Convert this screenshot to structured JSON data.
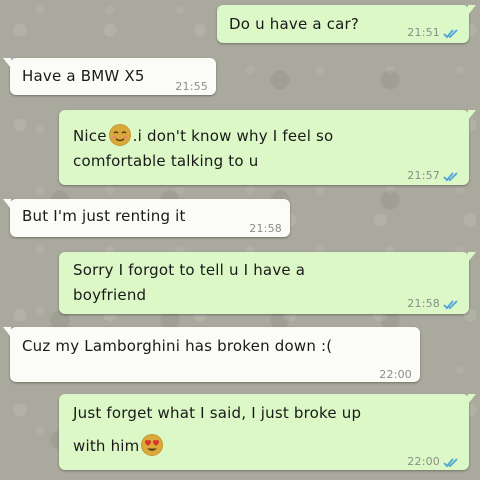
{
  "messages": [
    {
      "dir": "out",
      "text": "Do u have a car?",
      "time": "21:51",
      "status_icon": "double-check-icon"
    },
    {
      "dir": "in",
      "text": "Have a BMW X5",
      "time": "21:55"
    },
    {
      "dir": "out",
      "text_before_emoji": "Nice",
      "emoji": "blushing-smile-emoji",
      "text_after_emoji": ".i don't know why I feel so",
      "text_line2": "comfortable talking to u",
      "time": "21:57",
      "status_icon": "double-check-icon"
    },
    {
      "dir": "in",
      "text": "But I'm just renting it",
      "time": "21:58"
    },
    {
      "dir": "out",
      "text": "Sorry I forgot to tell u I have a",
      "text_line2": "boyfriend",
      "time": "21:58",
      "status_icon": "double-check-icon"
    },
    {
      "dir": "in",
      "text": "Cuz my Lamborghini has broken down :(",
      "time": "22:00"
    },
    {
      "dir": "out",
      "text": "Just forget what I said, I just broke up",
      "text_line2_before_emoji": "with him",
      "emoji": "heart-eyes-emoji",
      "time": "22:00",
      "status_icon": "double-check-icon"
    }
  ],
  "colors": {
    "outgoing_bubble": "#dbf8c6",
    "incoming_bubble": "#fbfbf8",
    "read_tick": "#4fa6d8",
    "timestamp": "#8a8f88",
    "wallpaper": "#aaa99d"
  }
}
